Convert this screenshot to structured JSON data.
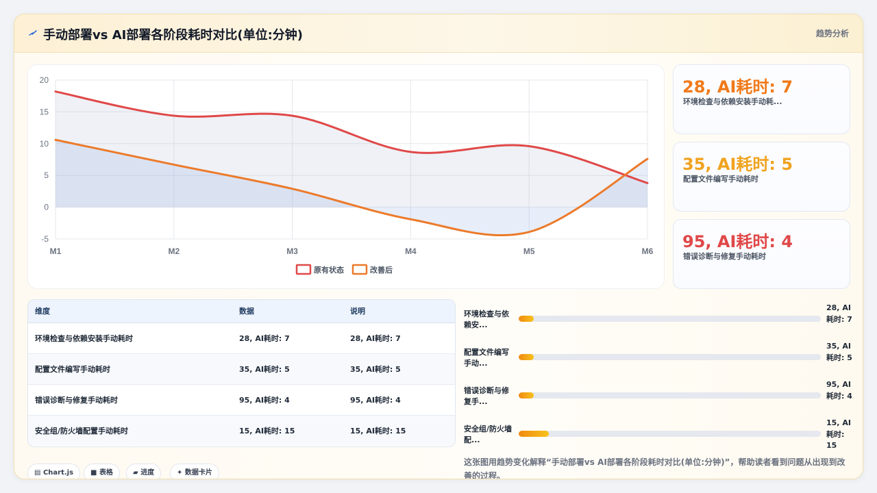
{
  "header": {
    "icon": "lightning-icon",
    "title": "手动部署vs AI部署各阶段耗时对比(单位:分钟)",
    "analysis_link": "趋势分析"
  },
  "chart_data": {
    "type": "line",
    "categories": [
      "M1",
      "M2",
      "M3",
      "M4",
      "M5",
      "M6"
    ],
    "ylim": [
      -5,
      20
    ],
    "yticks": [
      20,
      15,
      10,
      5,
      0,
      -5
    ],
    "grid": true,
    "legend": "bottom",
    "series": [
      {
        "name": "原有状态",
        "values": [
          18.2,
          14.4,
          14.4,
          8.7,
          9.6,
          3.8
        ],
        "color": "#e04848"
      },
      {
        "name": "改善后",
        "values": [
          10.6,
          6.7,
          2.9,
          -1.9,
          -3.9,
          7.6
        ],
        "color": "#ec7a2a"
      }
    ]
  },
  "stats": [
    {
      "value": "28, AI耗时: 7",
      "label": "环境检查与依赖安装手动耗...",
      "color": "#f07a1a"
    },
    {
      "value": "35, AI耗时: 5",
      "label": "配置文件编写手动耗时",
      "color": "#f0a31f"
    },
    {
      "value": "95, AI耗时: 4",
      "label": "错误诊断与修复手动耗时",
      "color": "#e04848"
    }
  ],
  "table": {
    "headers": [
      "维度",
      "数据",
      "说明"
    ],
    "rows": [
      [
        "环境检查与依赖安装手动耗时",
        "28, AI耗时: 7",
        "28, AI耗时: 7"
      ],
      [
        "配置文件编写手动耗时",
        "35, AI耗时: 5",
        "35, AI耗时: 5"
      ],
      [
        "错误诊断与修复手动耗时",
        "95, AI耗时: 4",
        "95, AI耗时: 4"
      ],
      [
        "安全组/防火墙配置手动耗时",
        "15, AI耗时: 15",
        "15, AI耗时: 15"
      ]
    ]
  },
  "progress": [
    {
      "label": "环境检查与依赖安...",
      "value": "28, AI耗时: 7",
      "percent": 5
    },
    {
      "label": "配置文件编写手动...",
      "value": "35, AI耗时: 5",
      "percent": 5
    },
    {
      "label": "错误诊断与修复手...",
      "value": "95, AI耗时: 4",
      "percent": 5
    },
    {
      "label": "安全组/防火墙配...",
      "value": "15, AI耗时: 15",
      "percent": 10
    }
  ],
  "description": "这张图用趋势变化解释“手动部署vs AI部署各阶段耗时对比(单位:分钟)”，帮助读者看到问题从出现到改善的过程。",
  "tags": [
    {
      "icon": "chart-icon",
      "label": "Chart.js"
    },
    {
      "icon": "table-icon",
      "label": "表格"
    },
    {
      "icon": "folder-icon",
      "label": "进度"
    },
    {
      "icon": "sparkle-icon",
      "label": "数据卡片"
    }
  ]
}
